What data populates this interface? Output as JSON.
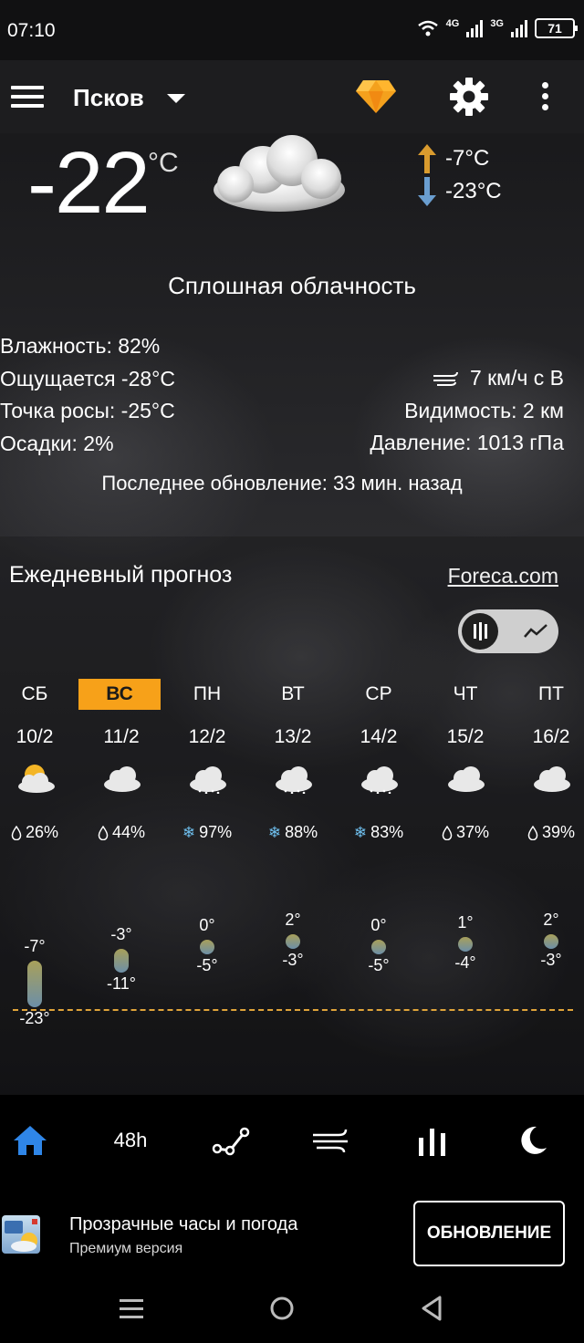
{
  "status_bar": {
    "time": "07:10",
    "net1": "4G",
    "net2": "3G",
    "battery": "71"
  },
  "app_bar": {
    "city": "Псков",
    "icons": [
      "menu-icon",
      "premium-diamond-icon",
      "settings-gear-icon",
      "more-vert-icon"
    ]
  },
  "current": {
    "temp": "-22",
    "unit": "°C",
    "high": "-7°C",
    "low": "-23°C",
    "condition": "Сплошная облачность",
    "humidity": "Влажность: 82%",
    "feels_like": "Ощущается -28°C",
    "dew_point": "Точка росы: -25°C",
    "precip": "Осадки: 2%",
    "wind": "7 км/ч с В",
    "visibility": "Видимость: 2 км",
    "pressure": "Давление: 1013 гПа",
    "updated": "Последнее обновление: 33 мин. назад"
  },
  "daily": {
    "title": "Ежедневный прогноз",
    "source": "Foreca.com",
    "days": [
      {
        "name": "СБ",
        "date": "10/2",
        "icon": "partly-cloudy-icon",
        "precip": "26%",
        "precip_type": "rain",
        "high": "-7°",
        "low": "-23°",
        "high_val": -7,
        "low_val": -23,
        "selected": false
      },
      {
        "name": "ВС",
        "date": "11/2",
        "icon": "cloud-icon",
        "precip": "44%",
        "precip_type": "rain",
        "high": "-3°",
        "low": "-11°",
        "high_val": -3,
        "low_val": -11,
        "selected": true
      },
      {
        "name": "ПН",
        "date": "12/2",
        "icon": "snow-cloud-icon",
        "precip": "97%",
        "precip_type": "snow",
        "high": "0°",
        "low": "-5°",
        "high_val": 0,
        "low_val": -5,
        "selected": false
      },
      {
        "name": "ВТ",
        "date": "13/2",
        "icon": "snow-cloud-icon",
        "precip": "88%",
        "precip_type": "snow",
        "high": "2°",
        "low": "-3°",
        "high_val": 2,
        "low_val": -3,
        "selected": false
      },
      {
        "name": "СР",
        "date": "14/2",
        "icon": "snow-cloud-icon",
        "precip": "83%",
        "precip_type": "snow",
        "high": "0°",
        "low": "-5°",
        "high_val": 0,
        "low_val": -5,
        "selected": false
      },
      {
        "name": "ЧТ",
        "date": "15/2",
        "icon": "cloud-icon",
        "precip": "37%",
        "precip_type": "rain",
        "high": "1°",
        "low": "-4°",
        "high_val": 1,
        "low_val": -4,
        "selected": false
      },
      {
        "name": "ПТ",
        "date": "16/2",
        "icon": "cloud-icon",
        "precip": "39%",
        "precip_type": "rain",
        "high": "2°",
        "low": "-3°",
        "high_val": 2,
        "low_val": -3,
        "selected": false
      }
    ]
  },
  "bottom_nav": {
    "items": [
      "home-icon",
      "48h",
      "graph-icon",
      "wind-icon",
      "bar-chart-icon",
      "moon-icon"
    ],
    "label_48h": "48h",
    "active": "home-icon"
  },
  "promo": {
    "title": "Прозрачные часы и погода",
    "subtitle": "Премиум версия",
    "button": "ОБНОВЛЕНИЕ"
  },
  "colors": {
    "accent_orange": "#f7a119",
    "home_blue": "#2f86e8",
    "snow_blue": "#6fc0ef"
  }
}
